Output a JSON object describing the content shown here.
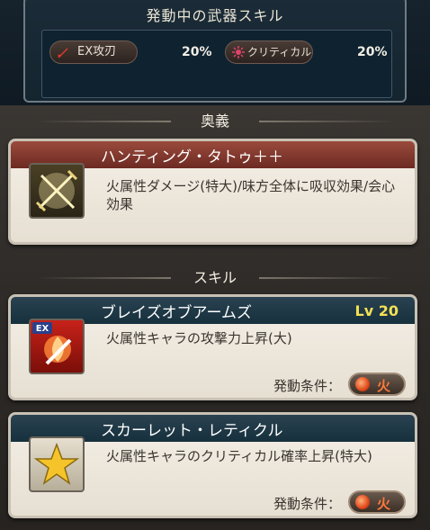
{
  "weapon_skills": {
    "title": "発動中の武器スキル",
    "items": [
      {
        "label": "EX攻刃",
        "value": "20%",
        "icon": "sword-icon",
        "color": "#e23a2a"
      },
      {
        "label": "クリティカル",
        "value": "20%",
        "icon": "burst-icon",
        "color": "#e0436a"
      }
    ]
  },
  "ougi": {
    "header": "奥義",
    "name": "ハンティング・タトゥ＋＋",
    "description": "火属性ダメージ(特大)/味方全体に吸収効果/会心効果",
    "icon": "crossed-swords-icon"
  },
  "skills": {
    "header": "スキル",
    "condition_label": "発動条件：",
    "element_label": "火",
    "items": [
      {
        "name": "ブレイズオブアームズ",
        "level": "Lv 20",
        "description": "火属性キャラの攻撃力上昇(大)",
        "icon": "ex-flame-sword-icon",
        "badge": "EX"
      },
      {
        "name": "スカーレット・レティクル",
        "description": "火属性キャラのクリティカル確率上昇(特大)",
        "icon": "star-icon"
      }
    ]
  },
  "colors": {
    "ougi_bar": "#7d3428",
    "skill_bar": "#1e3745",
    "level": "#f3e054",
    "fire": "#e0481a"
  }
}
